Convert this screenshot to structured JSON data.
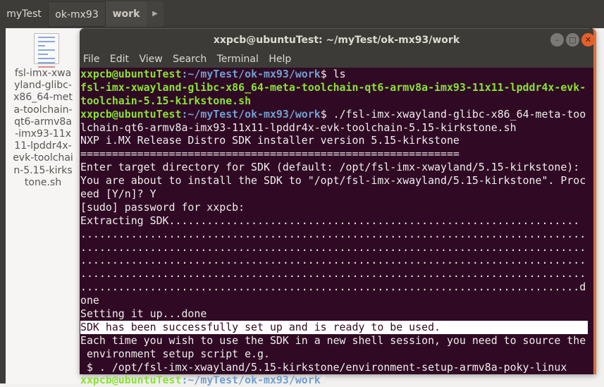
{
  "tabs": [
    "myTest",
    "ok-mx93",
    "work",
    "▶"
  ],
  "file": {
    "name": "fsl-imx-xwayland-glibc-x86_64-meta-toolchain-qt6-armv8a-imx93-11x11-lpddr4x-evk-toolchain-5.15-kirkstone.sh"
  },
  "terminal": {
    "title": "xxpcb@ubuntuTest: ~/myTest/ok-mx93/work",
    "menu": [
      "File",
      "Edit",
      "View",
      "Search",
      "Terminal",
      "Help"
    ],
    "prompt_user": "xxpcb@ubuntuTest",
    "prompt_path": ":~/myTest/ok-mx93/work",
    "cmd1": "$ ls",
    "ls_out": [
      "fsl-imx-xwayland-glibc-x86_64-meta-toolchain-qt6-armv8a-imx93-11x11-lpddr4x-evk-",
      "toolchain-5.15-kirkstone.sh"
    ],
    "cmd2": "$ ./fsl-imx-xwayland-glibc-x86_64-meta-too",
    "lines": [
      "lchain-qt6-armv8a-imx93-11x11-lpddr4x-evk-toolchain-5.15-kirkstone.sh",
      "NXP i.MX Release Distro SDK installer version 5.15-kirkstone",
      "============================================================",
      "Enter target directory for SDK (default: /opt/fsl-imx-xwayland/5.15-kirkstone):",
      "You are about to install the SDK to \"/opt/fsl-imx-xwayland/5.15-kirkstone\". Proc",
      "eed [Y/n]? Y",
      "[sudo] password for xxpcb:",
      "Extracting SDK.................................................................",
      "................................................................................",
      "................................................................................",
      "................................................................................",
      "................................................................................",
      "...............................................................................d",
      "one",
      "Setting it up...done"
    ],
    "highlight": "SDK has been successfully set up and is ready to be used.",
    "tail": [
      "Each time you wish to use the SDK in a new shell session, you need to source the",
      " environment setup script e.g.",
      " $ . /opt/fsl-imx-xwayland/5.15-kirkstone/environment-setup-armv8a-poky-linux"
    ],
    "final_prompt_end": "$ "
  }
}
